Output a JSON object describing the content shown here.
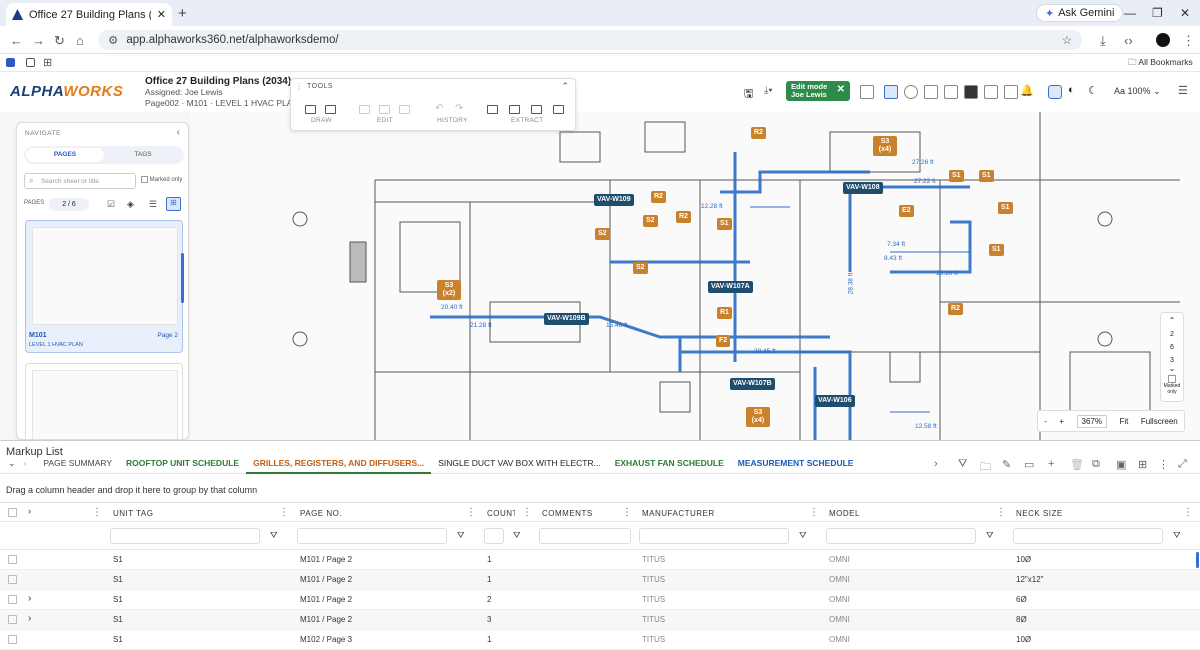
{
  "browser": {
    "tab_title": "Office 27 Building Plans (2034)",
    "ask_gemini": "Ask Gemini",
    "url": "app.alphaworks360.net/alphaworksdemo/",
    "all_bookmarks": "All Bookmarks"
  },
  "app": {
    "logo_main": "ALPHA",
    "logo_accent": "WORKS",
    "doc_title": "Office 27 Building Plans (2034)",
    "assigned": "Assigned: Joe Lewis",
    "page_path": "Page002 · M101 · LEVEL 1 HVAC PLAN",
    "edit_mode_label": "Edit mode",
    "edit_mode_user": "Joe Lewis",
    "zoom_label": "Aa",
    "zoom_value": "100%"
  },
  "tools": {
    "title": "TOOLS",
    "groups": [
      "DRAW",
      "EDIT",
      "HISTORY",
      "EXTRACT"
    ]
  },
  "navigate": {
    "title": "NAVIGATE",
    "tabs": [
      "PAGES",
      "TAGS"
    ],
    "search_placeholder": "Search sheet or title",
    "marked_only": "Marked only",
    "pages_label": "PAGES",
    "page_indicator": "2 / 6",
    "thumb1_name": "M101",
    "thumb1_desc": "LEVEL 1 HVAC PLAN",
    "thumb1_page": "Page 2"
  },
  "drawing": {
    "page_controls": [
      "2",
      "6",
      "3"
    ],
    "marked_only": "Marked only",
    "zoom_minus": "-",
    "zoom_plus": "+",
    "zoom_pct": "367%",
    "fit": "Fit",
    "fullscreen": "Fullscreen",
    "vav_tags": [
      "VAV-W109",
      "VAV-W109B",
      "VAV-W107A",
      "VAV-W108",
      "VAV-W107B",
      "VAV-W106"
    ],
    "s_tags": [
      "S3 (x4)",
      "S3 (x2)",
      "S3 (x4)",
      "S2",
      "S2",
      "S2",
      "S1",
      "S1",
      "S1",
      "S1",
      "S1"
    ],
    "r_tags": [
      "R2",
      "R2",
      "R2",
      "R2",
      "R1",
      "F2"
    ],
    "e_tags": [
      "E2"
    ],
    "measurements": [
      "27.26 ft",
      "21.28 ft",
      "20.40 ft",
      "15.46 ft",
      "38.45 ft",
      "12.28 ft",
      "27.22 ft",
      "8.43 ft",
      "19.10 ft",
      "7.34 ft",
      "12.58 ft",
      "28.38 ft"
    ]
  },
  "markup": {
    "title": "Markup List",
    "tabs": [
      {
        "label": "PAGE SUMMARY"
      },
      {
        "label": "ROOFTOP UNIT SCHEDULE"
      },
      {
        "label": "GRILLES, REGISTERS, AND DIFFUSERS..."
      },
      {
        "label": "SINGLE DUCT VAV BOX WITH ELECTR..."
      },
      {
        "label": "EXHAUST FAN SCHEDULE"
      },
      {
        "label": "MEASUREMENT SCHEDULE"
      }
    ],
    "group_hint": "Drag a column header and drop it here to group by that column",
    "columns": [
      "UNIT TAG",
      "PAGE NO.",
      "COUNT",
      "COMMENTS",
      "MANUFACTURER",
      "MODEL",
      "NECK SIZE"
    ],
    "rows": [
      {
        "tag": "S1",
        "page": "M101 / Page 2",
        "count": "1",
        "comments": "",
        "mfr": "TITUS",
        "model": "OMNI",
        "neck": "10Ø"
      },
      {
        "tag": "S1",
        "page": "M101 / Page 2",
        "count": "1",
        "comments": "",
        "mfr": "TITUS",
        "model": "OMNI",
        "neck": "12\"x12\""
      },
      {
        "tag": "S1",
        "page": "M101 / Page 2",
        "count": "2",
        "comments": "",
        "mfr": "TITUS",
        "model": "OMNI",
        "neck": "6Ø"
      },
      {
        "tag": "S1",
        "page": "M101 / Page 2",
        "count": "3",
        "comments": "",
        "mfr": "TITUS",
        "model": "OMNI",
        "neck": "8Ø"
      },
      {
        "tag": "S1",
        "page": "M102 / Page 3",
        "count": "1",
        "comments": "",
        "mfr": "TITUS",
        "model": "OMNI",
        "neck": "10Ø"
      }
    ]
  }
}
